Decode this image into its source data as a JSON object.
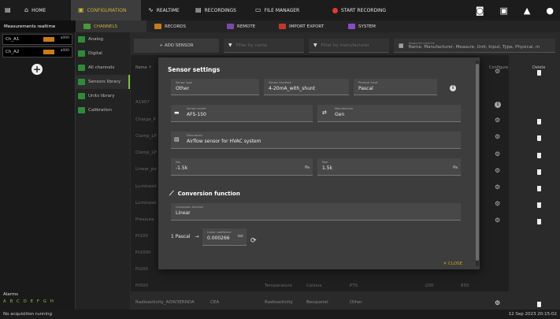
{
  "topbar": {
    "items": [
      {
        "label": "HOME",
        "icon": "⌂"
      },
      {
        "label": "CONFIGURATION",
        "icon": "▣"
      },
      {
        "label": "REALTIME",
        "icon": "∿"
      },
      {
        "label": "RECORDINGS",
        "icon": "▤"
      },
      {
        "label": "FILE MANAGER",
        "icon": "▭"
      }
    ],
    "start_recording": "START RECORDING",
    "accent": "#c9b23a",
    "record_color": "#e23b2e"
  },
  "subbar": {
    "title": "Measurements realtime",
    "items": [
      {
        "label": "CHANNELS",
        "color": "#4a9a3a"
      },
      {
        "label": "RECORDS",
        "color": "#c97b1c"
      },
      {
        "label": "REMOTE",
        "color": "#7a4aa8"
      },
      {
        "label": "IMPORT EXPORT",
        "color": "#c0392b"
      },
      {
        "label": "SYSTEM",
        "color": "#8a4ac8"
      }
    ]
  },
  "channels": [
    {
      "name": "Ch_A1",
      "value": "a000"
    },
    {
      "name": "Ch_A2",
      "value": "a000"
    }
  ],
  "categories": [
    {
      "label": "Analog"
    },
    {
      "label": "Digital"
    },
    {
      "label": "All channels"
    },
    {
      "label": "Sensors library"
    },
    {
      "label": "Units library"
    },
    {
      "label": "Calibration"
    }
  ],
  "toolbar": {
    "add_sensor": "+ ADD SENSOR",
    "filter_name": "Filter by name",
    "filter_manufacturer": "Filter by manufacturer",
    "displayed_label": "Displayed columns",
    "displayed_value": "Name, Manufacturer, Measure, Unit, Input, Type, Physical, m"
  },
  "table": {
    "headers": {
      "name": "Name ↑",
      "configure": "Configure",
      "delete": "Delete"
    },
    "rows": [
      {
        "name": "A1907"
      },
      {
        "name": "Charge_P"
      },
      {
        "name": "Clamp_LP"
      },
      {
        "name": "Clamp_LP"
      },
      {
        "name": "Linear_po"
      },
      {
        "name": "Luminosit"
      },
      {
        "name": "Luminosit"
      },
      {
        "name": "Pressure"
      },
      {
        "name": "Pt100"
      },
      {
        "name": "Pt1000"
      },
      {
        "name": "Pt200"
      },
      {
        "name": "Pt500",
        "measure": "Temperature",
        "unit": "Celsius",
        "input": "PTS",
        "min": "-200",
        "max": "850"
      },
      {
        "name": "Radioactivity_ADW3ERNDA",
        "manufacturer": "CEA",
        "measure": "Radioactivity",
        "unit": "Becquerel",
        "input": "Other"
      }
    ]
  },
  "modal": {
    "title": "Sensor settings",
    "sensor_type": {
      "label": "Sensor type",
      "value": "Other"
    },
    "sensor_interface": {
      "label": "Sensor interface",
      "value": "4-20mA_with_shunt"
    },
    "physical_input": {
      "label": "Physical input",
      "value": "Pascal"
    },
    "sensor_name": {
      "label": "Sensor name*",
      "value": "AFS-150"
    },
    "manufacturer": {
      "label": "Manufacturer",
      "value": "Gen"
    },
    "description": {
      "label": "Description",
      "value": "Airflow sensor for HVAC system"
    },
    "min": {
      "label": "Min",
      "value": "-1.5k",
      "unit": "Pa"
    },
    "max": {
      "label": "Max",
      "value": "1.5k",
      "unit": "Pa"
    },
    "conversion_title": "Conversion function",
    "conversion_function": {
      "label": "Conversion function",
      "value": "Linear"
    },
    "conv_from": "1 Pascal",
    "conv_arrow": "→",
    "linear_coeff": {
      "label": "Linear coefficient",
      "value": "0.000266",
      "unit": "Volt"
    },
    "close": "✕ CLOSE"
  },
  "left": {
    "alarms_label": "Alarms",
    "alarms_letters": "A B C D E F G H"
  },
  "status": {
    "left": "No acquisition running",
    "right": "12 Sep 2023 20:15:02"
  }
}
